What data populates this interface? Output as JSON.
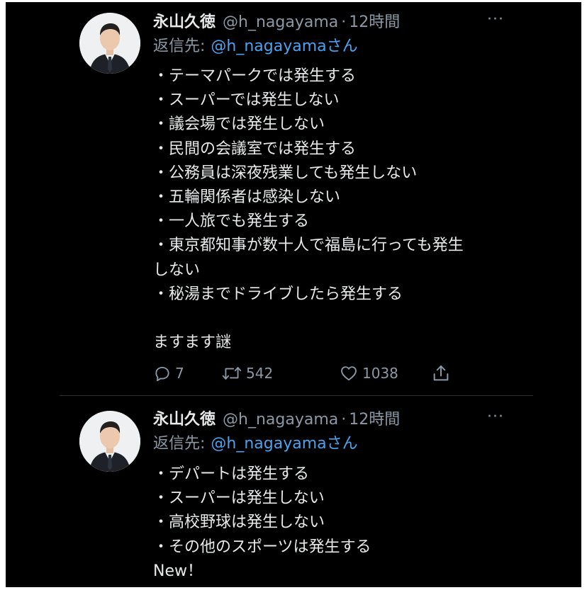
{
  "tweets": [
    {
      "author_name": "永山久徳",
      "handle": "@h_nagayama",
      "separator": "·",
      "time": "12時間",
      "more": "···",
      "reply_label": "返信先:",
      "reply_to": "@h_nagayamaさん",
      "lines": [
        "・テーマパークでは発生する",
        "・スーパーでは発生しない",
        "・議会場では発生しない",
        "・民間の会議室では発生する",
        "・公務員は深夜残業しても発生しない",
        "・五輪関係者は感染しない",
        "・一人旅でも発生する",
        "・東京都知事が数十人で福島に行っても発生",
        "しない",
        "・秘湯までドライブしたら発生する",
        "",
        "ますます謎"
      ],
      "stats": {
        "replies": "7",
        "retweets": "542",
        "likes": "1038"
      }
    },
    {
      "author_name": "永山久徳",
      "handle": "@h_nagayama",
      "separator": "·",
      "time": "12時間",
      "more": "···",
      "reply_label": "返信先:",
      "reply_to": "@h_nagayamaさん",
      "lines": [
        "・デパートは発生する",
        "・スーパーは発生しない",
        "・高校野球は発生しない",
        "・その他のスポーツは発生する",
        "New！"
      ]
    }
  ],
  "icons": {
    "reply": "reply-icon",
    "retweet": "retweet-icon",
    "like": "heart-icon",
    "share": "share-icon"
  },
  "colors": {
    "background": "#000000",
    "text": "#e7e9ea",
    "muted": "#8b98a5",
    "link": "#4aa3f0"
  }
}
